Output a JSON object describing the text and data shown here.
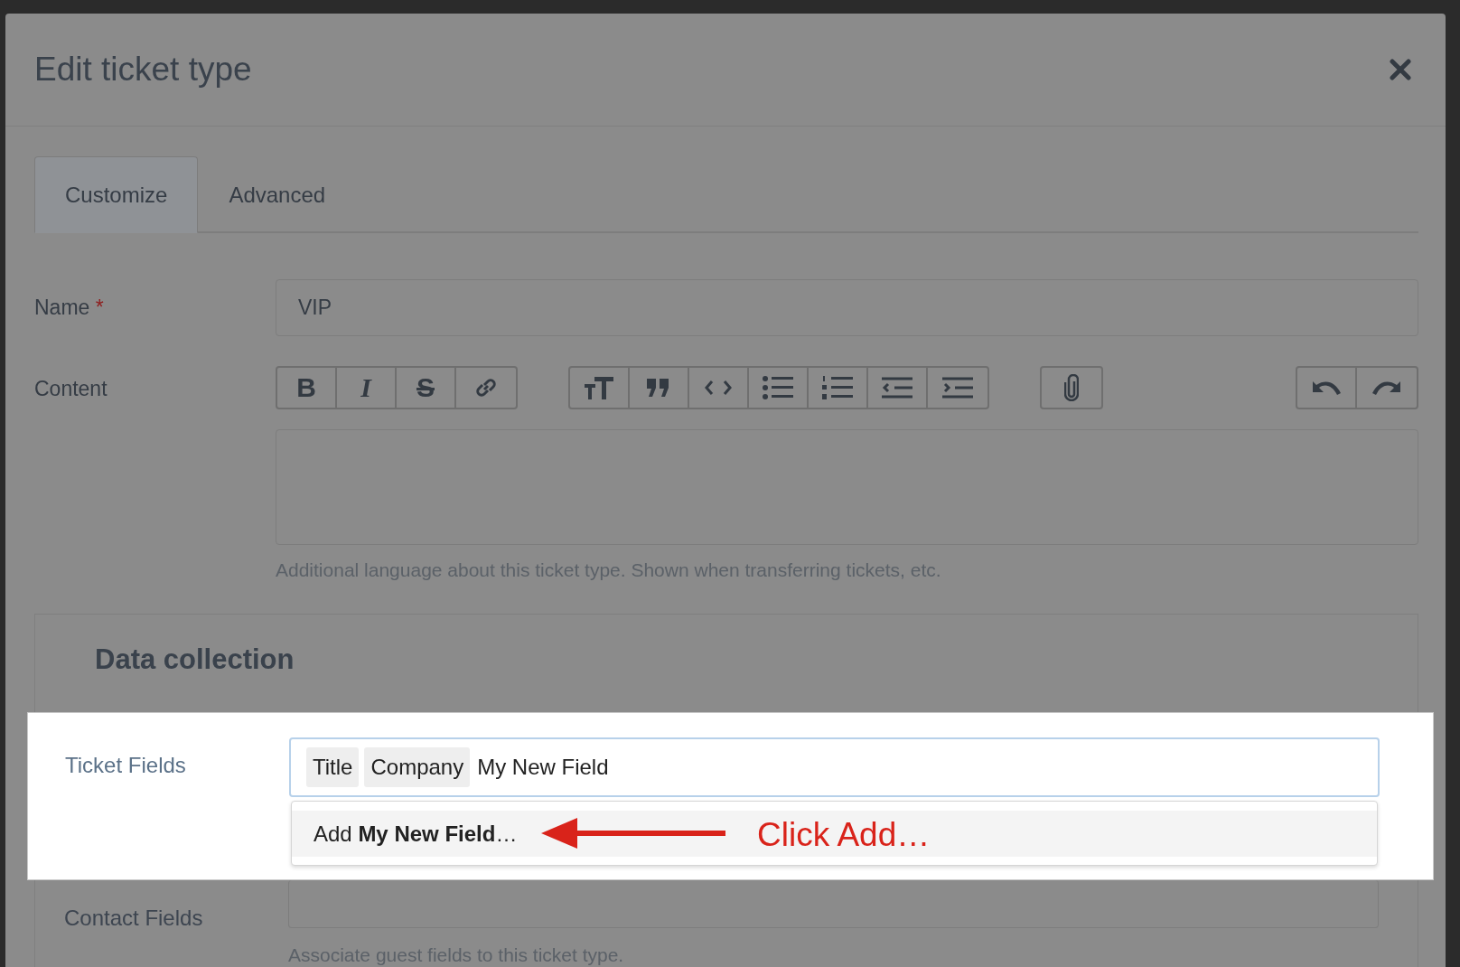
{
  "dialog": {
    "title": "Edit ticket type"
  },
  "tabs": [
    {
      "label": "Customize",
      "selected": true
    },
    {
      "label": "Advanced",
      "selected": false
    }
  ],
  "name_field": {
    "label": "Name",
    "required_mark": "*",
    "value": "VIP"
  },
  "content_field": {
    "label": "Content",
    "help": "Additional language about this ticket type. Shown when transferring tickets, etc.",
    "toolbar": [
      [
        {
          "kind": "bold",
          "glyph": "B"
        },
        {
          "kind": "italic",
          "glyph": "I"
        },
        {
          "kind": "strike",
          "glyph": "S"
        },
        {
          "kind": "link"
        }
      ],
      [
        {
          "kind": "heading"
        },
        {
          "kind": "quote"
        },
        {
          "kind": "code"
        },
        {
          "kind": "bullets"
        },
        {
          "kind": "numbers"
        },
        {
          "kind": "outdent"
        },
        {
          "kind": "indent"
        }
      ],
      [
        {
          "kind": "attach"
        }
      ],
      [
        {
          "kind": "undo"
        },
        {
          "kind": "redo"
        }
      ]
    ]
  },
  "data_collection": {
    "title": "Data collection",
    "ticket_fields": {
      "label": "Ticket Fields",
      "chips": [
        "Title",
        "Company"
      ],
      "value": "My New Field",
      "option": "Add **My New Field**…"
    },
    "annotation": "Click Add…",
    "contact_fields": {
      "label": "Contact Fields",
      "help": "Associate guest fields to this ticket type."
    }
  }
}
